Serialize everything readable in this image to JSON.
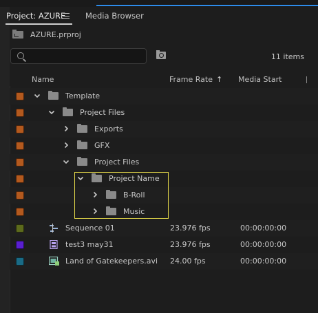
{
  "tabs": [
    {
      "label": "Project: AZURE",
      "active": true
    },
    {
      "label": "Media Browser",
      "active": false
    }
  ],
  "project": {
    "filename": "AZURE.prproj"
  },
  "search": {
    "placeholder": "",
    "value": ""
  },
  "item_count": "11 items",
  "columns": {
    "name": "Name",
    "frame_rate": "Frame Rate",
    "frame_rate_sort": "↑",
    "media_start": "Media Start"
  },
  "rows": [
    {
      "name": "Template",
      "type": "folder",
      "expanded": true,
      "label_color": "#b3591e",
      "frame_rate": "",
      "media_start": ""
    },
    {
      "name": "Project Files",
      "type": "folder",
      "expanded": true,
      "label_color": "#b3591e",
      "frame_rate": "",
      "media_start": ""
    },
    {
      "name": "Exports",
      "type": "folder",
      "expanded": false,
      "label_color": "#b3591e",
      "frame_rate": "",
      "media_start": ""
    },
    {
      "name": "GFX",
      "type": "folder",
      "expanded": false,
      "label_color": "#b3591e",
      "frame_rate": "",
      "media_start": ""
    },
    {
      "name": "Project Files",
      "type": "folder",
      "expanded": true,
      "label_color": "#b3591e",
      "frame_rate": "",
      "media_start": ""
    },
    {
      "name": "Project Name",
      "type": "folder",
      "expanded": true,
      "label_color": "#b3591e",
      "frame_rate": "",
      "media_start": ""
    },
    {
      "name": "B-Roll",
      "type": "folder",
      "expanded": false,
      "label_color": "#b3591e",
      "frame_rate": "",
      "media_start": ""
    },
    {
      "name": "Music",
      "type": "folder",
      "expanded": false,
      "label_color": "#b3591e",
      "frame_rate": "",
      "media_start": ""
    },
    {
      "name": "Sequence 01",
      "type": "sequence",
      "label_color": "#5c6a1c",
      "frame_rate": "23.976 fps",
      "media_start": "00:00:00:00"
    },
    {
      "name": "test3 may31",
      "type": "clip",
      "label_color": "#5a1fd0",
      "frame_rate": "23.976 fps",
      "media_start": "00:00:00:00"
    },
    {
      "name": "Land of Gatekeepers.avi",
      "type": "video",
      "label_color": "#1a6b86",
      "frame_rate": "24.00 fps",
      "media_start": "00:00:00:00"
    }
  ],
  "colors": {
    "accent_blue": "#2d8ceb",
    "highlight": "#e4d94a"
  },
  "icons": [
    "menu-icon",
    "project-file-icon",
    "search-icon",
    "new-bin-icon",
    "folder-icon",
    "chevron-right-icon",
    "chevron-down-icon",
    "sequence-icon",
    "clip-icon",
    "video-clip-icon"
  ]
}
